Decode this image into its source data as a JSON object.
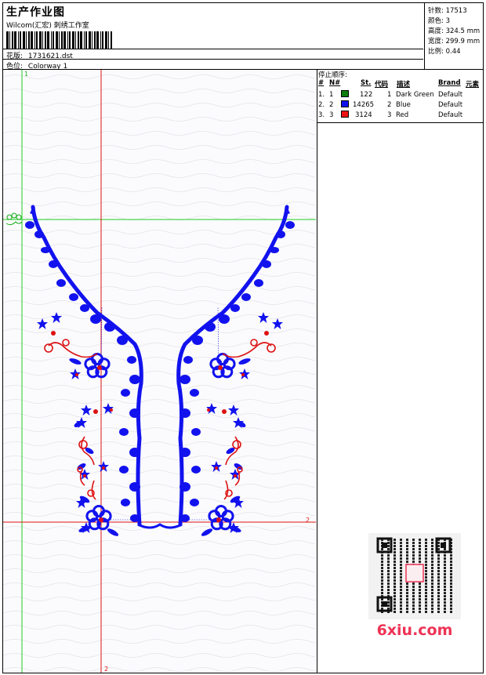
{
  "header": {
    "title": "生产作业图",
    "subtitle": "Wilcom(汇宏) 刺绣工作室",
    "design_label": "花版:",
    "design_file": "1731621.dst",
    "colorway_label": "色位:",
    "colorway": "Colorway 1"
  },
  "stats": [
    {
      "label": "针数:",
      "value": "17513"
    },
    {
      "label": "颜色:",
      "value": "3"
    },
    {
      "label": "高度:",
      "value": "324.5 mm"
    },
    {
      "label": "宽度:",
      "value": "299.9 mm"
    },
    {
      "label": "比例:",
      "value": "0.44"
    }
  ],
  "stop_sequence": {
    "title": "停止顺序:",
    "columns": [
      "#",
      "N#",
      "St.",
      "代码",
      "描述",
      "Brand",
      "元素"
    ],
    "rows": [
      {
        "idx": "1.",
        "n": "1",
        "stitches": "122",
        "code": "1",
        "desc": "Dark Green",
        "brand": "Default",
        "color": "#0b7d0b"
      },
      {
        "idx": "2.",
        "n": "2",
        "stitches": "14265",
        "code": "2",
        "desc": "Blue",
        "brand": "Default",
        "color": "#1010ee"
      },
      {
        "idx": "3.",
        "n": "3",
        "stitches": "3124",
        "code": "3",
        "desc": "Red",
        "brand": "Default",
        "color": "#ee1111"
      }
    ]
  },
  "canvas": {
    "guide_label_1_top": "1",
    "guide_label_2_right": "2",
    "guide_label_2_bottom": "2",
    "colors": {
      "green": "#22cc22",
      "red": "#dd1111",
      "blue": "#1212ee",
      "background": "#fbfbfd"
    }
  },
  "watermark": {
    "text": "6xiu.com",
    "qr_icon": "qr-code-icon",
    "color": "#ee3355"
  }
}
